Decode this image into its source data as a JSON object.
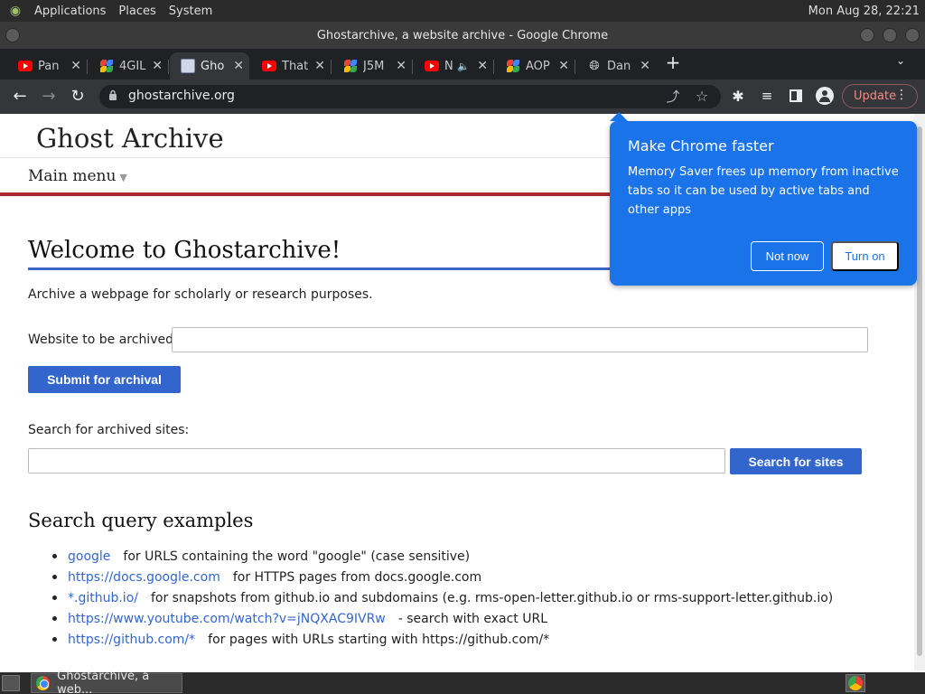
{
  "top_panel": {
    "menus": [
      "Applications",
      "Places",
      "System"
    ],
    "clock": "Mon Aug 28, 22:21"
  },
  "window": {
    "title": "Ghostarchive, a website archive - Google Chrome"
  },
  "tabs": [
    {
      "title": "Pan",
      "favicon": "youtube-icon"
    },
    {
      "title": "4GIL",
      "favicon": "pinwheel-icon"
    },
    {
      "title": "Gho",
      "favicon": "ghost-archive-icon",
      "active": true
    },
    {
      "title": "That",
      "favicon": "youtube-icon"
    },
    {
      "title": "J5M",
      "favicon": "pinwheel-icon"
    },
    {
      "title": "N",
      "favicon": "youtube-icon",
      "audio": true
    },
    {
      "title": "AOP",
      "favicon": "pinwheel-icon"
    },
    {
      "title": "Dan",
      "favicon": "globe-icon"
    }
  ],
  "toolbar": {
    "url": "ghostarchive.org",
    "update_label": "Update"
  },
  "site": {
    "title": "Ghost Archive",
    "main_menu": "Main menu",
    "heading": "Welcome to Ghostarchive!",
    "intro": "Archive a webpage for scholarly or research purposes.",
    "website_label": "Website to be archived:",
    "website_value": "",
    "submit_label": "Submit for archival",
    "search_label": "Search for archived sites:",
    "search_value": "",
    "search_button": "Search for sites",
    "examples_heading": "Search query examples",
    "examples": [
      {
        "link": "google",
        "desc": "for URLS containing the word \"google\" (case sensitive)"
      },
      {
        "link": "https://docs.google.com",
        "desc": "for HTTPS pages from docs.google.com"
      },
      {
        "link": "*.github.io/",
        "desc": "for snapshots from github.io and subdomains (e.g. rms-open-letter.github.io or rms-support-letter.github.io)"
      },
      {
        "link": "https://www.youtube.com/watch?v=jNQXAC9IVRw",
        "desc": "- search with exact URL"
      },
      {
        "link": "https://github.com/*",
        "desc": "for pages with URLs starting with https://github.com/*"
      }
    ]
  },
  "popup": {
    "title": "Make Chrome faster",
    "body": "Memory Saver frees up memory from inactive tabs so it can be used by active tabs and other apps",
    "not_now": "Not now",
    "turn_on": "Turn on"
  },
  "taskbar": {
    "task_title": "Ghostarchive, a web..."
  },
  "colors": {
    "accent_blue": "#3366cc",
    "popup_blue": "#1a73e8",
    "red_bar": "#a82a2a"
  }
}
